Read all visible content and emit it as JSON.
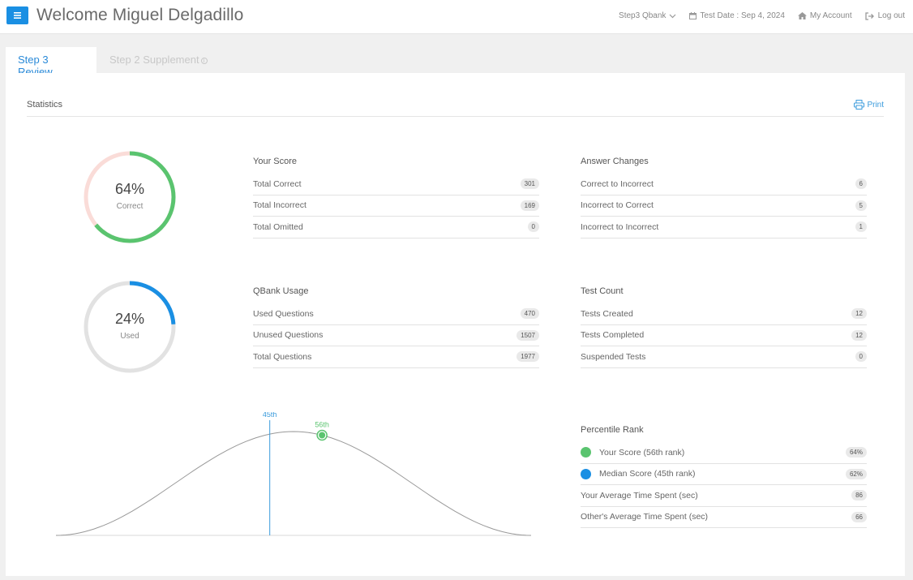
{
  "header": {
    "welcome": "Welcome Miguel Delgadillo",
    "qbank": "Step3 Qbank",
    "test_date": "Test Date : Sep 4, 2024",
    "my_account": "My Account",
    "logout": "Log out"
  },
  "tabs": [
    {
      "label": "Step 3 Review",
      "active": true
    },
    {
      "label": "Step 2 Supplement",
      "active": false
    }
  ],
  "panel": {
    "title": "Statistics",
    "print": "Print"
  },
  "colors": {
    "accent": "#1a8fe3",
    "correct": "#5ac46f",
    "incorrect": "#fadcd8",
    "usage": "#1a8fe3",
    "usage_track": "#e2e2e2"
  },
  "donuts": {
    "score": {
      "percent": "64%",
      "label": "Correct",
      "fraction": 0.64
    },
    "usage": {
      "percent": "24%",
      "label": "Used",
      "fraction": 0.24
    }
  },
  "your_score": {
    "heading": "Your Score",
    "rows": [
      {
        "label": "Total Correct",
        "value": "301"
      },
      {
        "label": "Total Incorrect",
        "value": "169"
      },
      {
        "label": "Total Omitted",
        "value": "0"
      }
    ]
  },
  "answer_changes": {
    "heading": "Answer Changes",
    "rows": [
      {
        "label": "Correct to Incorrect",
        "value": "6"
      },
      {
        "label": "Incorrect to Correct",
        "value": "5"
      },
      {
        "label": "Incorrect to Incorrect",
        "value": "1"
      }
    ]
  },
  "qbank_usage": {
    "heading": "QBank Usage",
    "rows": [
      {
        "label": "Used Questions",
        "value": "470"
      },
      {
        "label": "Unused Questions",
        "value": "1507"
      },
      {
        "label": "Total Questions",
        "value": "1977"
      }
    ]
  },
  "test_count": {
    "heading": "Test Count",
    "rows": [
      {
        "label": "Tests Created",
        "value": "12"
      },
      {
        "label": "Tests Completed",
        "value": "12"
      },
      {
        "label": "Suspended Tests",
        "value": "0"
      }
    ]
  },
  "percentile": {
    "heading": "Percentile Rank",
    "rows": [
      {
        "label": "Your Score (56th rank)",
        "value": "64%"
      },
      {
        "label": "Median Score (45th rank)",
        "value": "62%"
      },
      {
        "label": "Your Average Time Spent (sec)",
        "value": "86"
      },
      {
        "label": "Other's Average Time Spent (sec)",
        "value": "66"
      }
    ]
  },
  "curve": {
    "median_label": "45th",
    "median_rank": 45,
    "your_label": "56th",
    "your_rank": 56
  }
}
